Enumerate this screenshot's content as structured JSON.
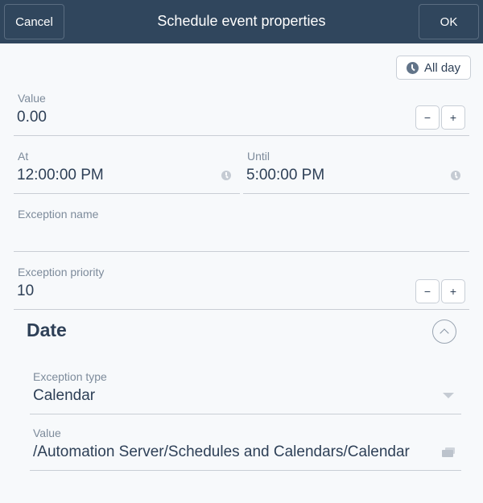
{
  "header": {
    "title": "Schedule event properties",
    "cancel_label": "Cancel",
    "ok_label": "OK"
  },
  "all_day": {
    "label": "All day",
    "icon": "clock-icon"
  },
  "fields": {
    "value": {
      "label": "Value",
      "value": "0.00",
      "decrement": "−",
      "increment": "+"
    },
    "at": {
      "label": "At",
      "value": "12:00:00 PM",
      "icon": "clock-icon"
    },
    "until": {
      "label": "Until",
      "value": "5:00:00 PM",
      "icon": "clock-icon"
    },
    "exception_name": {
      "label": "Exception name",
      "value": ""
    },
    "exception_priority": {
      "label": "Exception priority",
      "value": "10",
      "decrement": "−",
      "increment": "+"
    }
  },
  "date_section": {
    "title": "Date",
    "collapse_icon": "chevron-up-icon",
    "exception_type": {
      "label": "Exception type",
      "value": "Calendar",
      "icon": "dropdown-arrow-icon"
    },
    "value": {
      "label": "Value",
      "value": "/Automation Server/Schedules and Calendars/Calendar",
      "icon": "folder-icon"
    }
  },
  "colors": {
    "header_bg": "#30465d",
    "page_bg": "#f7f9fb",
    "text": "#2e4057",
    "label": "#7d8b9b",
    "divider": "#c9ced5"
  }
}
